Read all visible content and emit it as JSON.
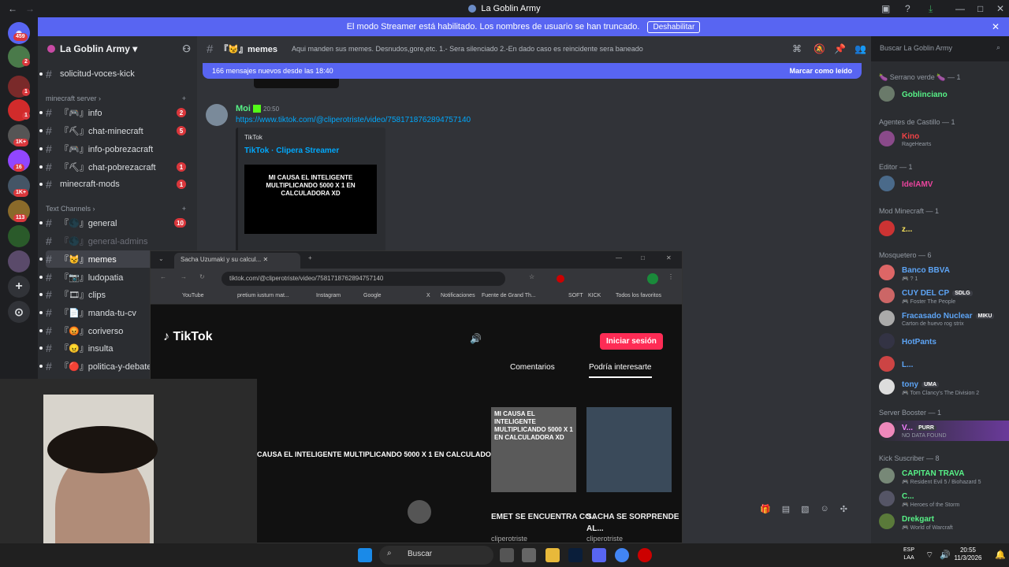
{
  "window": {
    "title": "La Goblin Army"
  },
  "banner": {
    "text": "El modo Streamer está habilitado. Los nombres de usuario se han truncado.",
    "button": "Deshabilitar"
  },
  "guilds": [
    {
      "badge": "459",
      "icon": "discord-home-icon"
    },
    {
      "badge": "2"
    },
    {
      "badge": "1"
    },
    {
      "badge": "1"
    },
    {
      "badge": "1K+"
    },
    {
      "badge": "16"
    },
    {
      "badge": "1K+"
    },
    {
      "badge": "113"
    },
    {
      "badge": ""
    },
    {
      "badge": ""
    }
  ],
  "server": {
    "name": "La Goblin Army"
  },
  "sidebar": {
    "top_channel": "solicitud-voces-kick",
    "cat_minecraft": "minecraft server",
    "cat_text": "Text Channels",
    "minecraft": [
      {
        "name": "『🎮』info",
        "badge": "2"
      },
      {
        "name": "『⛏』chat-minecraft",
        "badge": "5"
      },
      {
        "name": "『🎮』info-pobrezacraft",
        "badge": ""
      },
      {
        "name": "『⛏』chat-pobrezacraft",
        "badge": "1"
      },
      {
        "name": "minecraft-mods",
        "badge": "1"
      }
    ],
    "text": [
      {
        "name": "『🌑』general",
        "badge": "10"
      },
      {
        "name": "『🌑』general-admins",
        "badge": ""
      },
      {
        "name": "『😼』memes",
        "badge": ""
      },
      {
        "name": "『📷』ludopatia",
        "badge": ""
      },
      {
        "name": "『🎞』clips",
        "badge": ""
      },
      {
        "name": "『📄』manda-tu-cv",
        "badge": ""
      },
      {
        "name": "『😡』coriverso",
        "badge": ""
      },
      {
        "name": "『😠』insulta",
        "badge": ""
      },
      {
        "name": "『🔴』politica-y-debate",
        "badge": ""
      }
    ]
  },
  "channel": {
    "name": "『😼』memes",
    "topic": "Aqui manden sus memes. Desnudos,gore,etc. 1.- Sera silenciado 2.-En dado caso es reincidente sera baneado"
  },
  "search": {
    "placeholder": "Buscar La Goblin Army"
  },
  "newmsg": {
    "text": "166 mensajes nuevos desde las 18:40",
    "action": "Marcar como leído"
  },
  "message": {
    "author": "Moi",
    "time": "20:50",
    "link": "https://www.tiktok.com/@cliperotriste/video/7581718762894757140",
    "embed_provider": "TikTok",
    "embed_title": "TikTok · Clipera Streamer",
    "embed_image_text": "MI CAUSA EL INTELIGENTE MULTIPLICANDO 5000 X 1 EN CALCULADORA XD"
  },
  "members": {
    "cats": [
      {
        "label": "🍆 Serrano verde 🍆 — 1",
        "members": [
          {
            "name": "Goblinciano",
            "color": "#57f287",
            "status": ""
          }
        ]
      },
      {
        "label": "Agentes de Castillo — 1",
        "members": [
          {
            "name": "Kino",
            "color": "#ed4245",
            "status": "RageHearts"
          }
        ]
      },
      {
        "label": "Editor — 1",
        "members": [
          {
            "name": "IdelAMV",
            "color": "#eb459e",
            "status": ""
          }
        ]
      },
      {
        "label": "Mod Minecraft — 1",
        "members": [
          {
            "name": "z...",
            "color": "#fee75c",
            "status": ""
          }
        ]
      },
      {
        "label": "Mosquetero — 6",
        "members": [
          {
            "name": "Banco BBVA",
            "color": "#5da4f5",
            "status": "🎮 ? 1"
          },
          {
            "name": "CUY DEL CP",
            "color": "#5da4f5",
            "status": "🎮 Foster The People",
            "tag": "SDLG"
          },
          {
            "name": "Fracasado Nuclear",
            "color": "#5da4f5",
            "status": "Carton de huevo rog strix",
            "tag": "MIKU"
          },
          {
            "name": "HotPants",
            "color": "#5da4f5",
            "status": ""
          },
          {
            "name": "L...",
            "color": "#5da4f5",
            "status": ""
          },
          {
            "name": "tony",
            "color": "#5da4f5",
            "status": "🎮 Tom Clancy's The Division 2",
            "tag": "UMA"
          }
        ]
      },
      {
        "label": "Server Booster — 1",
        "members": [
          {
            "name": "V...",
            "color": "#f47fff",
            "status": "NO DATA FOUND",
            "tag": "PURR"
          }
        ]
      },
      {
        "label": "Kick Suscriber — 8",
        "members": [
          {
            "name": "CAPITAN TRAVA",
            "color": "#57f287",
            "status": "🎮 Resident Evil 5 / Biohazard 5"
          },
          {
            "name": "C...",
            "color": "#57f287",
            "status": "🎮 Heroes of the Storm"
          },
          {
            "name": "Drekgart",
            "color": "#57f287",
            "status": "🎮 World of Warcraft"
          }
        ]
      }
    ]
  },
  "browser": {
    "tab_title": "Sacha Uzumaki y su calcul...",
    "url": "tiktok.com/@cliperotriste/video/7581718762894757140",
    "bookmarks": [
      "YouTube",
      "pretium iusturn mat...",
      "Instagram",
      "Google",
      "",
      "",
      "X",
      "Notificaciones",
      "Fuente de Grand Th...",
      "SOFT",
      "KICK",
      "Todos los favoritos"
    ],
    "logo": "TikTok",
    "login": "Iniciar sesión",
    "tab_comments": "Comentarios",
    "tab_interest": "Podría interesarte",
    "video_caption": "CAUSA EL INTELIGENTE MULTIPLICANDO 5000 X 1 EN CALCULADORA XD",
    "thumb_title": "MI CAUSA EL INTELIGENTE MULTIPLICANDO 5000 X 1 EN CALCULADORA XD",
    "video1": "EMET SE ENCUENTRA CO...",
    "video2": "SACHA SE SORPRENDE AL...",
    "author": "cliperotriste"
  },
  "taskbar": {
    "search": "Buscar",
    "lang1": "ESP",
    "lang2": "LAA",
    "time": "20:55",
    "date": "11/3/2026"
  }
}
